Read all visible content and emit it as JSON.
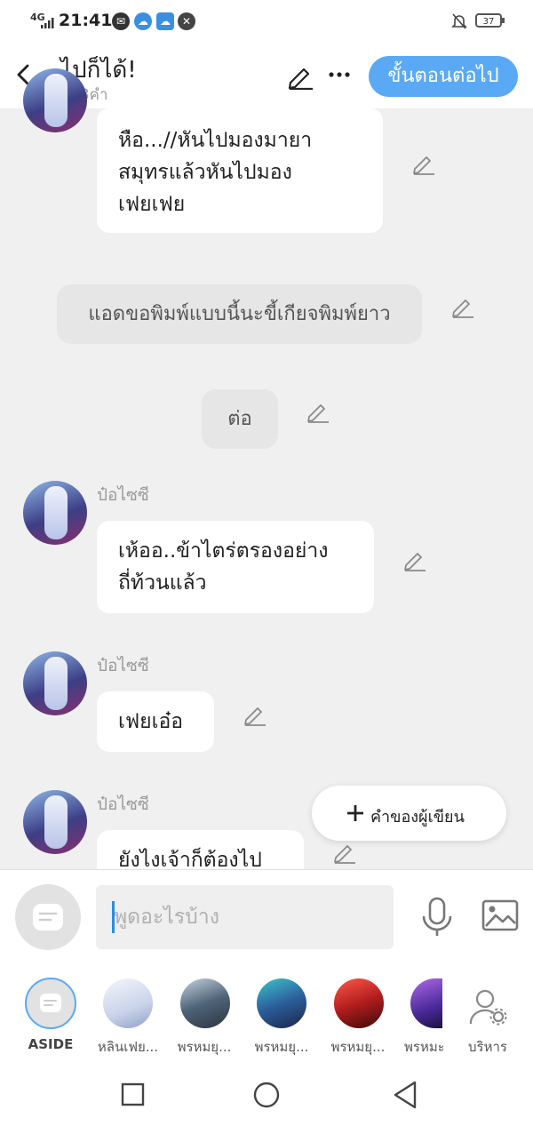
{
  "status_bar": {
    "network": "4G",
    "time": "21:41",
    "battery": "37"
  },
  "header": {
    "title": "ไปก็ได้!",
    "word_count": "798คำ",
    "next_button": "ขั้นตอนต่อไป"
  },
  "messages": [
    {
      "type": "character",
      "text_lines": [
        "หือ...//หันไปมองมายา",
        "สมุทรแล้วหันไปมอง",
        "เฟยเฟย"
      ]
    },
    {
      "type": "narration",
      "text": "แอดขอพิมพ์แบบนี้นะขี้เกียจพิมพ์ยาว"
    },
    {
      "type": "narration",
      "text": "ต่อ"
    },
    {
      "type": "character",
      "name": "ป๋อไซซี",
      "text_lines": [
        "เห้ออ..ข้าไตร่ตรองอย่าง",
        "ถี่ท้วนแล้ว"
      ]
    },
    {
      "type": "character",
      "name": "ป๋อไซซี",
      "text_lines": [
        "เฟยเอ๋อ"
      ]
    },
    {
      "type": "character",
      "name": "ป๋อไซซี",
      "text_lines": [
        "ยังไงเจ้าก็ต้องไป"
      ]
    }
  ],
  "author_note_button": "คำของผู้เขียน",
  "input": {
    "placeholder": "พูดอะไรบ้าง"
  },
  "characters": [
    {
      "label": "ASIDE"
    },
    {
      "label": "หลินเฟย..."
    },
    {
      "label": "พรหมยุ..."
    },
    {
      "label": "พรหมยุ..."
    },
    {
      "label": "พรหมยุ..."
    },
    {
      "label": "พรหมะ"
    },
    {
      "label": "บริหาร"
    }
  ],
  "colors": {
    "accent": "#5aa9f5",
    "bubble": "#ffffff",
    "background": "#f0f0f0",
    "narration": "#e6e6e6"
  }
}
